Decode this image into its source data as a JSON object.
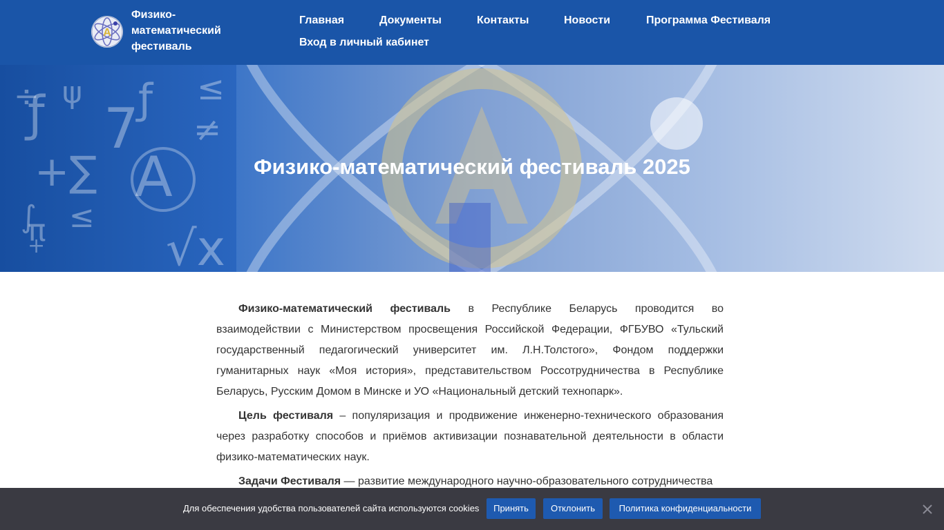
{
  "header": {
    "brand": [
      "Физико-",
      "математический",
      "фестиваль"
    ],
    "nav": [
      "Главная",
      "Документы",
      "Контакты",
      "Новости",
      "Программа Фестиваля",
      "Вход в личный кабинет"
    ]
  },
  "hero": {
    "title": "Физико-математический фестиваль 2025"
  },
  "content": {
    "p1_bold": "Физико-математический фестиваль",
    "p1_text": " в Республике Беларусь проводится во взаимодействии с Министерством просвещения Российской Федерации, ФГБУВО «Тульский государственный педагогический университет им. Л.Н.Толстого», Фондом поддержки гуманитарных наук «Моя история», представительством Россотрудничества в Республике Беларусь, Русским Домом в Минске и УО «Национальный детский технопарк».",
    "p2_bold": "Цель фестиваля",
    "p2_text": " – популяризация и продвижение инженерно-технического образования через разработку способов и приёмов активизации познавательной деятельности в области физико-математических наук.",
    "p3_bold": "Задачи Фестиваля",
    "p3_text": " — развитие международного научно-образовательного сотрудничества"
  },
  "cookie": {
    "text": "Для обеспечения удобства пользователей сайта используются cookies",
    "accept": "Принять",
    "decline": "Отклонить",
    "policy": "Политика конфиденциальности"
  },
  "colors": {
    "header_bg": "#1a55a8",
    "button_bg": "#1e5ab0",
    "cookie_bg": "#32323a"
  }
}
